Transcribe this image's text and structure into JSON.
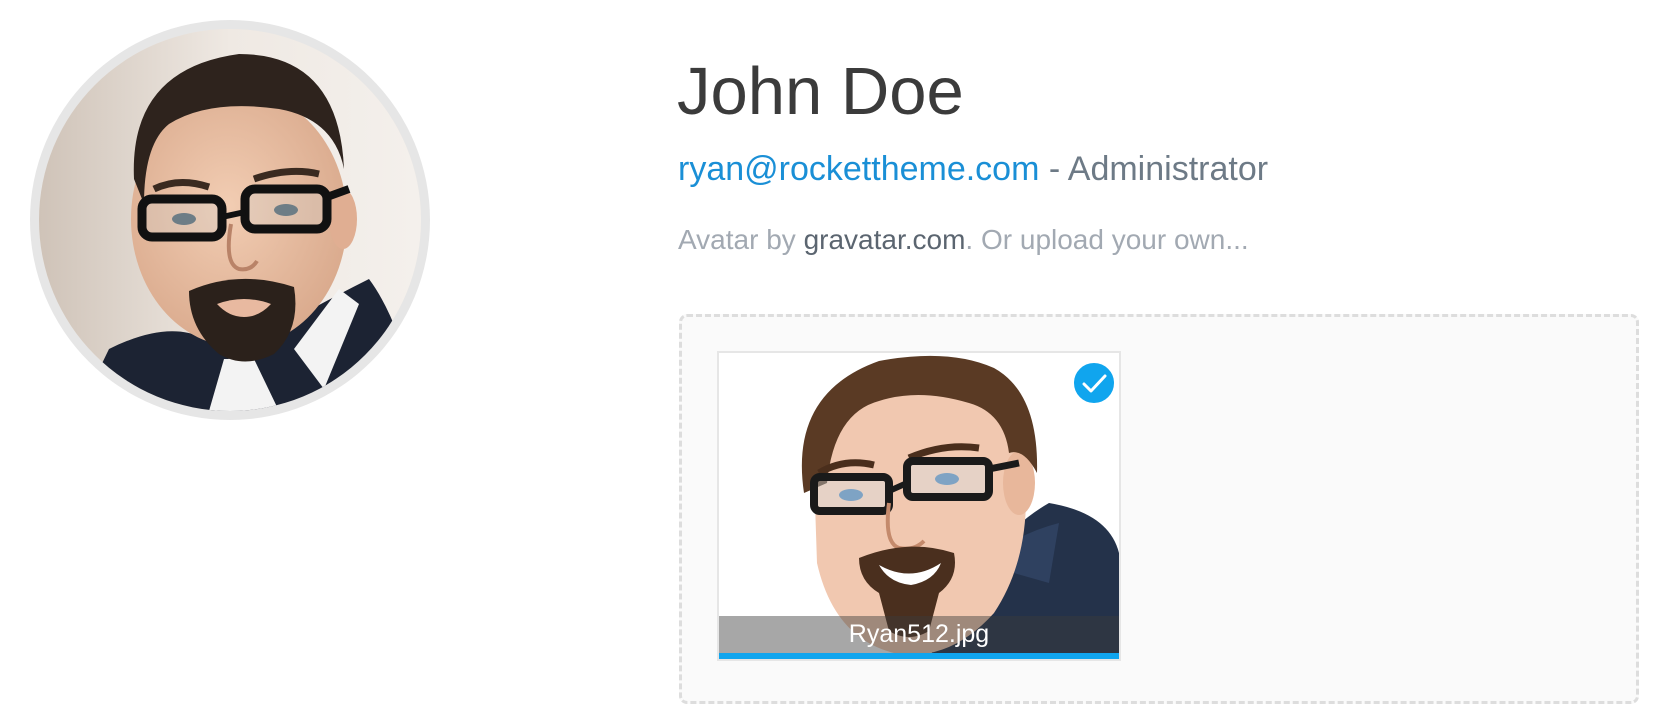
{
  "profile": {
    "name": "John Doe",
    "email": "ryan@rockettheme.com",
    "role_separator": " - ",
    "role": "Administrator"
  },
  "avatar_note": {
    "prefix": "Avatar by ",
    "service": "gravatar.com",
    "separator": ". ",
    "upload_text": "Or upload your own..."
  },
  "dropzone": {
    "files": [
      {
        "name": "Ryan512.jpg",
        "upload_progress": 1.0,
        "status": "complete"
      }
    ]
  },
  "colors": {
    "link": "#1a8fd6",
    "accent": "#10a5ee",
    "name_text": "#3b3b3b",
    "muted_text": "#a2a9b2"
  },
  "icons": {
    "status": "checkmark-icon"
  }
}
